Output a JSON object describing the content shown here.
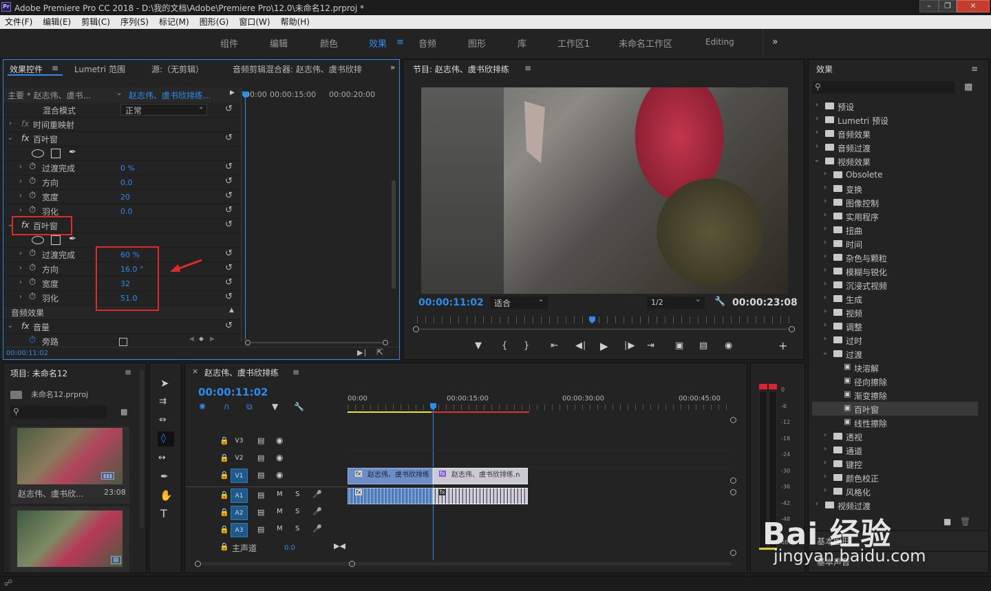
{
  "titlebar": {
    "app_icon": "Pr",
    "title": "Adobe Premiere Pro CC 2018 - D:\\我的文档\\Adobe\\Premiere Pro\\12.0\\未命名12.prproj *"
  },
  "menu": [
    "文件(F)",
    "编辑(E)",
    "剪辑(C)",
    "序列(S)",
    "标记(M)",
    "图形(G)",
    "窗口(W)",
    "帮助(H)"
  ],
  "workspaces": [
    "组件",
    "编辑",
    "颜色",
    "效果",
    "音频",
    "图形",
    "库",
    "工作区1",
    "未命名工作区",
    "Editing"
  ],
  "active_workspace": "效果",
  "effect_controls": {
    "tabs": [
      "效果控件",
      "Lumetri 范围",
      "源:（无剪辑）",
      "音频剪辑混合器: 赵志伟、虞书欣排"
    ],
    "master_clip": "主要 * 赵志伟、虞书...",
    "sequence_clip": "赵志伟、虞书欣排练...",
    "tl_times": [
      "00:00",
      "00:00:15:00",
      "00:00:20:00"
    ],
    "blend_label": "混合模式",
    "blend_value": "正常",
    "time_remap": "时间重映射",
    "effect1": {
      "name": "百叶窗",
      "props": [
        {
          "label": "过渡完成",
          "value": "0 %"
        },
        {
          "label": "方向",
          "value": "0.0"
        },
        {
          "label": "宽度",
          "value": "20"
        },
        {
          "label": "羽化",
          "value": "0.0"
        }
      ]
    },
    "effect2": {
      "name": "百叶窗",
      "props": [
        {
          "label": "过渡完成",
          "value": "60 %"
        },
        {
          "label": "方向",
          "value": "16.0 °"
        },
        {
          "label": "宽度",
          "value": "32"
        },
        {
          "label": "羽化",
          "value": "51.0"
        }
      ]
    },
    "audio_effects": "音频效果",
    "volume": "音量",
    "bypass": "旁路",
    "current_time": "00:00:11:02"
  },
  "program": {
    "title": "节目: 赵志伟、虞书欣排练",
    "timecode": "00:00:11:02",
    "fit": "适合",
    "quality": "1/2",
    "duration": "00:00:23:08"
  },
  "effects_panel": {
    "title": "效果",
    "items": [
      {
        "label": "预设",
        "level": 0,
        "open": false,
        "kind": "folder-star"
      },
      {
        "label": "Lumetri 预设",
        "level": 0,
        "open": false,
        "kind": "folder-star"
      },
      {
        "label": "音频效果",
        "level": 0,
        "open": false,
        "kind": "folder"
      },
      {
        "label": "音频过渡",
        "level": 0,
        "open": false,
        "kind": "folder"
      },
      {
        "label": "视频效果",
        "level": 0,
        "open": true,
        "kind": "folder"
      },
      {
        "label": "Obsolete",
        "level": 1,
        "open": false,
        "kind": "folder"
      },
      {
        "label": "变换",
        "level": 1,
        "open": false,
        "kind": "folder"
      },
      {
        "label": "图像控制",
        "level": 1,
        "open": false,
        "kind": "folder"
      },
      {
        "label": "实用程序",
        "level": 1,
        "open": false,
        "kind": "folder"
      },
      {
        "label": "扭曲",
        "level": 1,
        "open": false,
        "kind": "folder"
      },
      {
        "label": "时间",
        "level": 1,
        "open": false,
        "kind": "folder"
      },
      {
        "label": "杂色与颗粒",
        "level": 1,
        "open": false,
        "kind": "folder"
      },
      {
        "label": "模糊与锐化",
        "level": 1,
        "open": false,
        "kind": "folder"
      },
      {
        "label": "沉浸式视频",
        "level": 1,
        "open": false,
        "kind": "folder"
      },
      {
        "label": "生成",
        "level": 1,
        "open": false,
        "kind": "folder"
      },
      {
        "label": "视频",
        "level": 1,
        "open": false,
        "kind": "folder"
      },
      {
        "label": "调整",
        "level": 1,
        "open": false,
        "kind": "folder"
      },
      {
        "label": "过时",
        "level": 1,
        "open": false,
        "kind": "folder"
      },
      {
        "label": "过渡",
        "level": 1,
        "open": true,
        "kind": "folder"
      },
      {
        "label": "块溶解",
        "level": 2,
        "open": false,
        "kind": "effect"
      },
      {
        "label": "径向擦除",
        "level": 2,
        "open": false,
        "kind": "effect"
      },
      {
        "label": "渐变擦除",
        "level": 2,
        "open": false,
        "kind": "effect"
      },
      {
        "label": "百叶窗",
        "level": 2,
        "open": false,
        "kind": "effect",
        "selected": true
      },
      {
        "label": "线性擦除",
        "level": 2,
        "open": false,
        "kind": "effect"
      },
      {
        "label": "透视",
        "level": 1,
        "open": false,
        "kind": "folder"
      },
      {
        "label": "通道",
        "level": 1,
        "open": false,
        "kind": "folder"
      },
      {
        "label": "键控",
        "level": 1,
        "open": false,
        "kind": "folder"
      },
      {
        "label": "颜色校正",
        "level": 1,
        "open": false,
        "kind": "folder"
      },
      {
        "label": "风格化",
        "level": 1,
        "open": false,
        "kind": "folder"
      },
      {
        "label": "视频过渡",
        "level": 0,
        "open": false,
        "kind": "folder"
      }
    ],
    "bottom_labels": [
      "基本图形",
      "基本声音"
    ]
  },
  "project": {
    "title": "项目: 未命名12",
    "file": "未命名12.prproj",
    "clip1_name": "赵志伟、虞书欣...",
    "clip1_duration": "23:08"
  },
  "timeline": {
    "title": "赵志伟、虞书欣排练",
    "timecode": "00:00:11:02",
    "ruler": [
      "00:00",
      "00:00:15:00",
      "00:00:30:00",
      "00:00:45:00"
    ],
    "video_tracks": [
      "V3",
      "V2",
      "V1"
    ],
    "audio_tracks": [
      "A1",
      "A2",
      "A3"
    ],
    "master": "主声道",
    "master_value": "0.0",
    "clip_label": "赵志伟、虞书欣排练",
    "clip_label2": "赵志伟、虞书欣排练.n"
  },
  "meter": {
    "scale": [
      "0",
      "-6",
      "-12",
      "-18",
      "-24",
      "-30",
      "-36",
      "-42",
      "-48"
    ],
    "unit": "dB"
  },
  "watermark": {
    "text": "Bai 经验",
    "url": "jingyan.baidu.com"
  }
}
